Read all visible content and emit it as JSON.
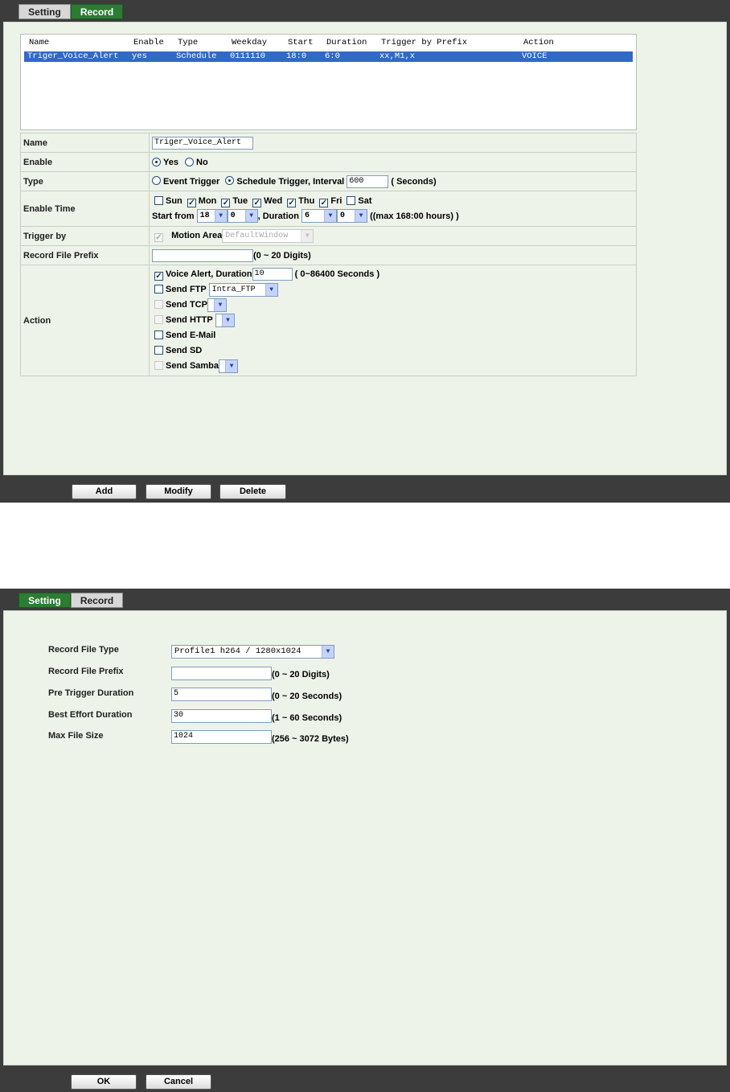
{
  "tabs": {
    "setting": "Setting",
    "record": "Record"
  },
  "record_panel": {
    "list_columns": [
      "Name",
      "Enable",
      "Type",
      "Weekday",
      "Start",
      "Duration",
      "Trigger by Prefix",
      "Action"
    ],
    "list_row": [
      "Triger_Voice_Alert",
      "yes",
      "Schedule",
      "0111110",
      "18:0",
      "6:0",
      "xx,M1,x",
      "VOICE"
    ],
    "name": {
      "label": "Name",
      "value": "Triger_Voice_Alert"
    },
    "enable": {
      "label": "Enable",
      "yes": "Yes",
      "no": "No",
      "selected": "Yes"
    },
    "type": {
      "label": "Type",
      "event": "Event Trigger",
      "schedule": "Schedule Trigger, Interval",
      "interval": "600",
      "unit": "( Seconds)"
    },
    "enable_time": {
      "label": "Enable Time",
      "days": [
        {
          "label": "Sun",
          "checked": false
        },
        {
          "label": "Mon",
          "checked": true
        },
        {
          "label": "Tue",
          "checked": true
        },
        {
          "label": "Wed",
          "checked": true
        },
        {
          "label": "Thu",
          "checked": true
        },
        {
          "label": "Fri",
          "checked": true
        },
        {
          "label": "Sat",
          "checked": false
        }
      ],
      "start_from_label": "Start from",
      "start_hour": "18",
      "start_min": "0",
      "duration_label": ", Duration",
      "duration_hour": "6",
      "duration_min": "0",
      "max_note": "((max 168:00 hours) )"
    },
    "trigger_by": {
      "label": "Trigger by",
      "motion_area": "Motion Area",
      "window": "DefaultWindow"
    },
    "record_prefix": {
      "label": "Record File Prefix",
      "value": "",
      "hint": "(0 ~ 20 Digits)"
    },
    "action": {
      "label": "Action",
      "voice_alert": "Voice Alert, Duration",
      "voice_duration": "10",
      "voice_hint": "( 0~86400 Seconds )",
      "send_ftp": "Send FTP",
      "ftp_value": "Intra_FTP",
      "send_tcp": "Send TCP",
      "send_http": "Send HTTP",
      "send_email": "Send E-Mail",
      "send_sd": "Send SD",
      "send_samba": "Send Samba"
    },
    "buttons": {
      "add": "Add",
      "modify": "Modify",
      "delete": "Delete"
    }
  },
  "setting_panel": {
    "record_file_type": {
      "label": "Record File Type",
      "value": "Profile1 h264 / 1280x1024"
    },
    "record_file_prefix": {
      "label": "Record File Prefix",
      "value": "",
      "hint": "(0 ~ 20 Digits)"
    },
    "pre_trigger": {
      "label": "Pre Trigger Duration",
      "value": "5",
      "hint": "(0 ~ 20 Seconds)"
    },
    "best_effort": {
      "label": "Best Effort Duration",
      "value": "30",
      "hint": "(1 ~ 60 Seconds)"
    },
    "max_file_size": {
      "label": "Max File Size",
      "value": "1024",
      "hint": "(256 ~ 3072 Bytes)"
    },
    "buttons": {
      "ok": "OK",
      "cancel": "Cancel"
    }
  }
}
